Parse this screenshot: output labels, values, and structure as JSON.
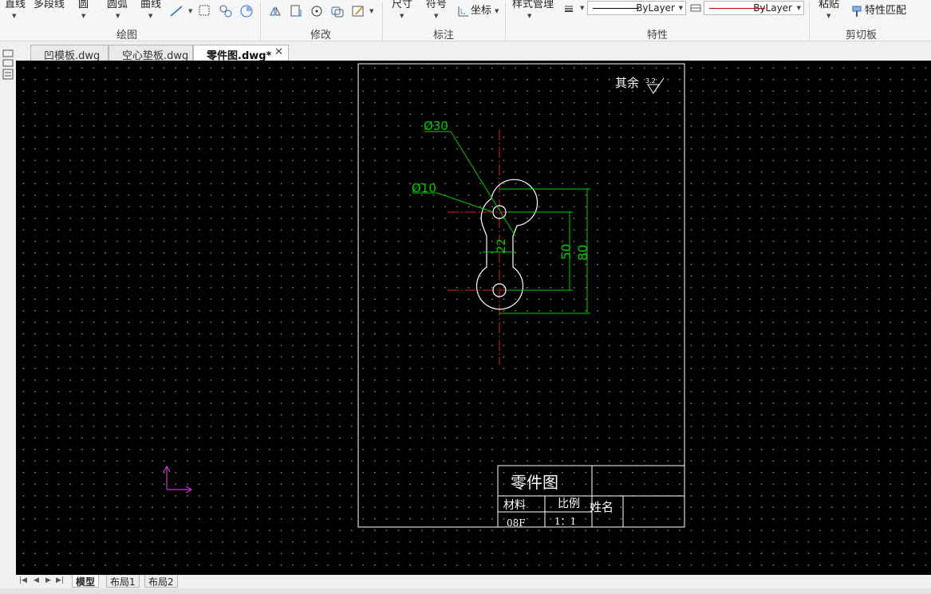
{
  "ribbon": {
    "draw": {
      "line": "直线",
      "polyline": "多段线",
      "circle": "圆",
      "arc": "圆弧",
      "curve": "曲线",
      "group_label": "绘图"
    },
    "modify": {
      "group_label": "修改"
    },
    "annotate": {
      "dimension": "尺寸",
      "symbol": "符号",
      "coordinate": "坐标",
      "group_label": "标注"
    },
    "properties": {
      "style_manager": "样式管理",
      "linetype": "ByLayer",
      "color": "ByLayer",
      "group_label": "特性",
      "linetype_color": "#000000",
      "color_swatch": "#d40000"
    },
    "clipboard": {
      "paste": "粘贴",
      "match_properties": "特性匹配",
      "group_label": "剪切板"
    }
  },
  "tabs": [
    {
      "label": "凹模板.dwg"
    },
    {
      "label": "空心垫板.dwg"
    },
    {
      "label": "零件图.dwg*",
      "active": true
    }
  ],
  "drawing": {
    "surface_note": "其余",
    "roughness": "3.2",
    "dim_phi30": "Ø30",
    "dim_phi10": "Ø10",
    "dim_22": "22",
    "dim_50": "50",
    "dim_80": "80",
    "title_block": {
      "name": "零件图",
      "material_label": "材料",
      "scale_label": "比例",
      "person_label": "姓名",
      "material_value": "08F",
      "scale_value": "1：1"
    },
    "colors": {
      "dimension": "#00cc00",
      "centerline": "#e02020",
      "geometry": "#ffffff",
      "ucs": "#cc33cc"
    }
  },
  "layout_tabs": [
    {
      "label": "模型",
      "active": true
    },
    {
      "label": "布局1"
    },
    {
      "label": "布局2"
    }
  ]
}
